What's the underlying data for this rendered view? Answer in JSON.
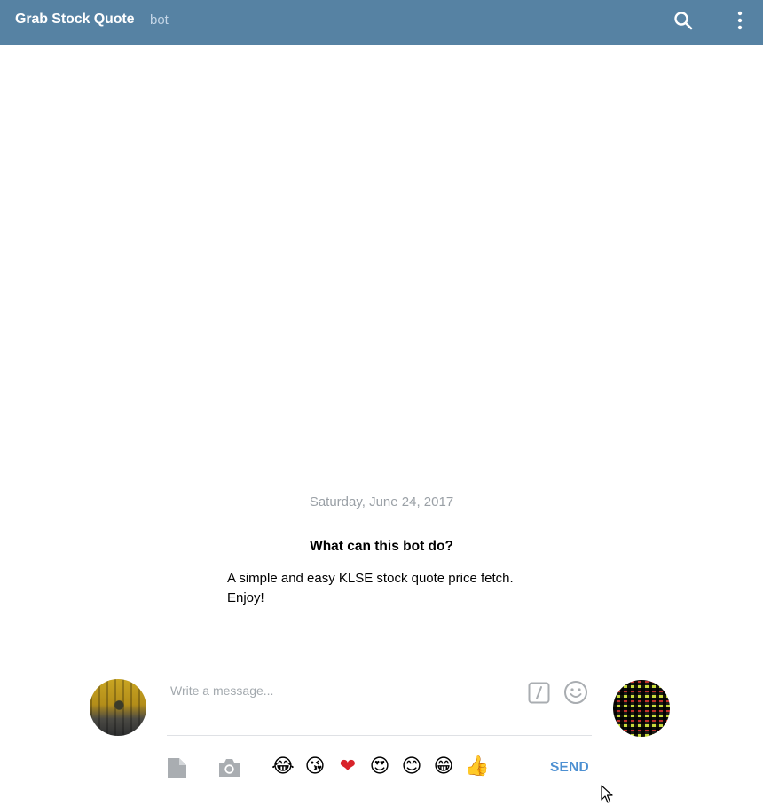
{
  "header": {
    "title": "Grab Stock Quote",
    "subtitle": "bot",
    "background_color": "#5682a3",
    "icons": [
      "search-icon",
      "more-vertical-icon"
    ]
  },
  "chat": {
    "date": "Saturday, June 24, 2017",
    "about_title": "What can this bot do?",
    "about_lines": [
      "A simple and easy KLSE stock quote price fetch.",
      "Enjoy!"
    ]
  },
  "composer": {
    "placeholder": "Write a message...",
    "value": "",
    "send_label": "SEND",
    "send_color": "#4d90d2",
    "emojis": [
      "😂",
      "😘",
      "❤",
      "😍",
      "😊",
      "😁",
      "👍"
    ],
    "icons": [
      "bot-command-icon",
      "emoji-smile-icon",
      "document-icon",
      "camera-icon"
    ]
  }
}
